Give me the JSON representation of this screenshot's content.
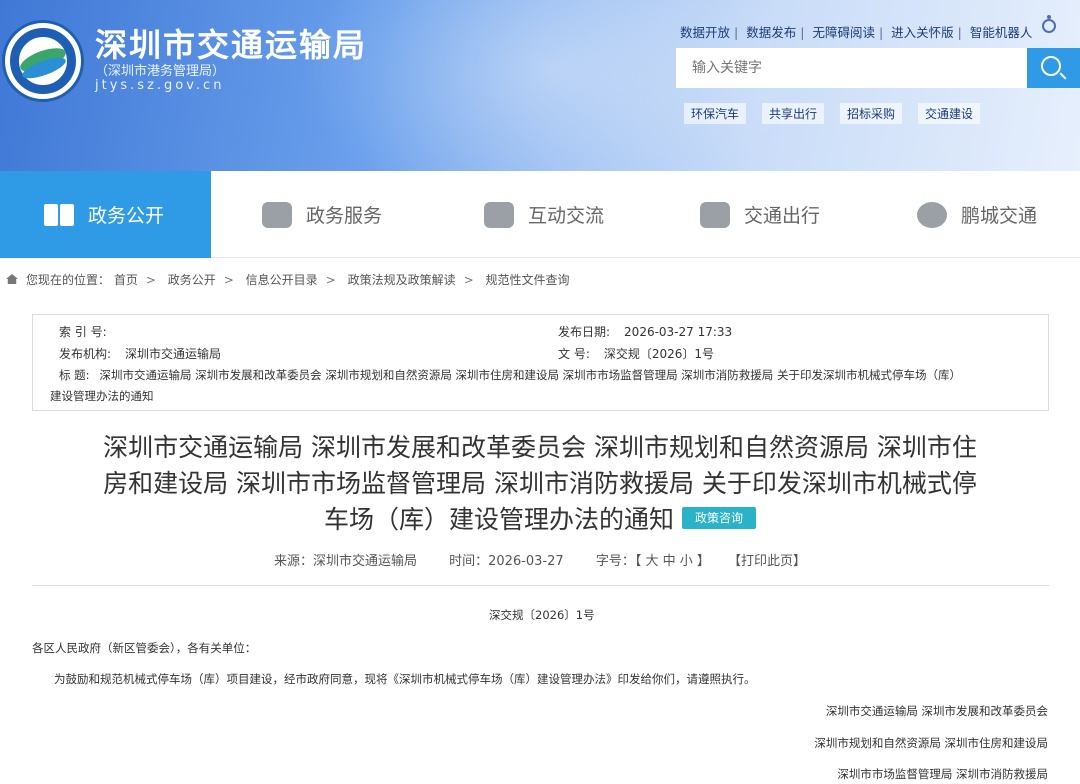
{
  "header": {
    "site_title": "深圳市交通运输局",
    "site_subtitle": "（深圳市港务管理局）",
    "site_url": "jtys.sz.gov.cn",
    "top_links": [
      "数据开放",
      "数据发布",
      "无障碍阅读",
      "进入关怀版",
      "智能机器人"
    ],
    "search_placeholder": "输入关键字",
    "hot_words": [
      "环保汽车",
      "共享出行",
      "招标采购",
      "交通建设"
    ]
  },
  "nav": {
    "items": [
      {
        "label": "政务公开",
        "icon": "book-icon",
        "active": true
      },
      {
        "label": "政务服务",
        "icon": "handshake-icon",
        "active": false
      },
      {
        "label": "互动交流",
        "icon": "chat-icon",
        "active": false
      },
      {
        "label": "交通出行",
        "icon": "map-person-icon",
        "active": false
      },
      {
        "label": "鹏城交通",
        "icon": "swirl-icon",
        "active": false
      }
    ]
  },
  "breadcrumb": {
    "prefix": "您现在的位置：",
    "items": [
      "首页",
      "政务公开",
      "信息公开目录",
      "政策法规及政策解读",
      "规范性文件查询"
    ]
  },
  "meta": {
    "index_label": "索 引 号:",
    "index_value": "",
    "date_label": "发布日期:",
    "date_value": "2026-03-27 17:33",
    "org_label": "发布机构:",
    "org_value": "深圳市交通运输局",
    "docno_label": "文    号:",
    "docno_value": "深交规〔2026〕1号",
    "title_label": "标    题:",
    "title_value_line1": "深圳市交通运输局 深圳市发展和改革委员会 深圳市规划和自然资源局 深圳市住房和建设局 深圳市市场监督管理局 深圳市消防救援局 关于印发深圳市机械式停车场（库）",
    "title_value_line2": "建设管理办法的通知"
  },
  "document": {
    "title_line1": "深圳市交通运输局 深圳市发展和改革委员会 深圳市规划和自然资源局 深圳市住",
    "title_line2": "房和建设局 深圳市市场监督管理局 深圳市消防救援局 关于印发深圳市机械式停",
    "title_line3": "车场（库）建设管理办法的通知",
    "tag": "政策咨询",
    "source": "来源：深圳市交通运输局",
    "time": "时间：2026-03-27",
    "font_size": "字号：【 大 中 小 】",
    "print": "【打印此页】",
    "doc_number": "深交规〔2026〕1号",
    "salutation": "各区人民政府（新区管委会），各有关单位：",
    "paragraph": "为鼓励和规范机械式停车场（库）项目建设，经市政府同意，现将《深圳市机械式停车场（库）建设管理办法》印发给你们，请遵照执行。",
    "signatures": [
      "深圳市交通运输局    深圳市发展和改革委员会",
      "深圳市规划和自然资源局    深圳市住房和建设局",
      "深圳市市场监督管理局    深圳市消防救援局"
    ]
  }
}
